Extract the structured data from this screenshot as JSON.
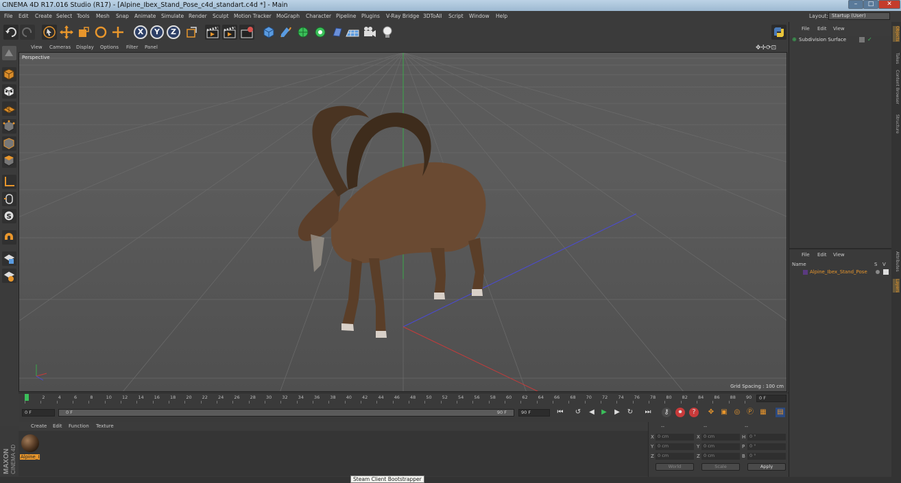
{
  "window": {
    "title": "CINEMA 4D R17.016 Studio (R17) - [Alpine_Ibex_Stand_Pose_c4d_standart.c4d *] - Main",
    "minimize": "–",
    "maximize": "□",
    "close": "✕"
  },
  "menu": [
    "File",
    "Edit",
    "Create",
    "Select",
    "Tools",
    "Mesh",
    "Snap",
    "Animate",
    "Simulate",
    "Render",
    "Sculpt",
    "Motion Tracker",
    "MoGraph",
    "Character",
    "Pipeline",
    "Plugins",
    "V-Ray Bridge",
    "3DToAll",
    "Script",
    "Window",
    "Help"
  ],
  "layout": {
    "label": "Layout:",
    "value": "Startup (User)"
  },
  "toolbar": {
    "axis_x": "X",
    "axis_y": "Y",
    "axis_z": "Z"
  },
  "viewport": {
    "menu": [
      "View",
      "Cameras",
      "Display",
      "Options",
      "Filter",
      "Panel"
    ],
    "label": "Perspective",
    "grid_spacing": "Grid Spacing : 100 cm",
    "icons": "✥✢⟳⊡"
  },
  "timeline": {
    "ticks": [
      "0",
      "2",
      "4",
      "6",
      "8",
      "10",
      "12",
      "14",
      "16",
      "18",
      "20",
      "22",
      "24",
      "26",
      "28",
      "30",
      "32",
      "34",
      "36",
      "38",
      "40",
      "42",
      "44",
      "46",
      "48",
      "50",
      "52",
      "54",
      "56",
      "58",
      "60",
      "62",
      "64",
      "66",
      "68",
      "70",
      "72",
      "74",
      "76",
      "78",
      "80",
      "82",
      "84",
      "86",
      "88",
      "90"
    ],
    "frame_display": "0 F",
    "start_field": "0 F",
    "range_start": "0 F",
    "range_end": "90 F",
    "end_field": "90 F"
  },
  "materials": {
    "menu": [
      "Create",
      "Edit",
      "Function",
      "Texture"
    ],
    "items": [
      {
        "label": "Alpine_I"
      }
    ]
  },
  "brand": {
    "maxon": "MAXON",
    "product": "CINEMA 4D"
  },
  "coords": {
    "headers": [
      "--",
      "--",
      "--"
    ],
    "rows": [
      {
        "a": "X",
        "av": "0 cm",
        "b": "X",
        "bv": "0 cm",
        "c": "H",
        "cv": "0 °"
      },
      {
        "a": "Y",
        "av": "0 cm",
        "b": "Y",
        "bv": "0 cm",
        "c": "P",
        "cv": "0 °"
      },
      {
        "a": "Z",
        "av": "0 cm",
        "b": "Z",
        "bv": "0 cm",
        "c": "B",
        "cv": "0 °"
      }
    ],
    "world": "World",
    "scale": "Scale",
    "apply": "Apply"
  },
  "object_manager": {
    "menu": [
      "File",
      "Edit",
      "View"
    ],
    "items": [
      {
        "name": "Subdivision Surface"
      }
    ]
  },
  "layer_manager": {
    "menu": [
      "File",
      "Edit",
      "View"
    ],
    "col_name": "Name",
    "col_s": "S",
    "col_v": "V",
    "items": [
      {
        "name": "Alpine_Ibex_Stand_Pose"
      }
    ]
  },
  "side_tabs": [
    "Objects",
    "Takes",
    "Content Browser",
    "Structure",
    "Attributes",
    "Layers"
  ],
  "tooltip": "Steam Client Bootstrapper",
  "colors": {
    "accent": "#e8962c",
    "bg": "#3a3a3a",
    "viewport": "#5a5a5a"
  }
}
